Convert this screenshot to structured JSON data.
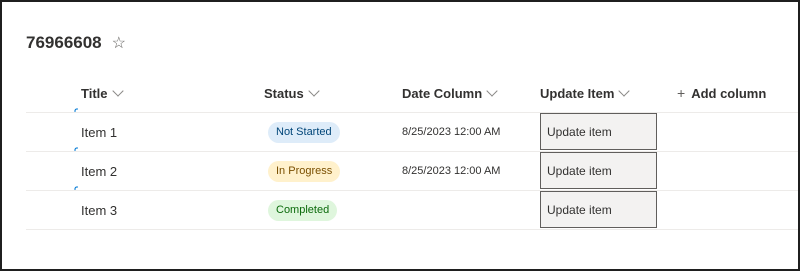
{
  "list": {
    "title": "76966608"
  },
  "columns": {
    "title": "Title",
    "status": "Status",
    "date": "Date Column",
    "update": "Update Item",
    "add": "Add column"
  },
  "rows": [
    {
      "title": "Item 1",
      "status": "Not Started",
      "status_bg": "#deecf9",
      "status_fg": "#004578",
      "date": "8/25/2023 12:00 AM",
      "button": "Update item"
    },
    {
      "title": "Item 2",
      "status": "In Progress",
      "status_bg": "#fff1cc",
      "status_fg": "#7a4f01",
      "date": "8/25/2023 12:00 AM",
      "button": "Update item"
    },
    {
      "title": "Item 3",
      "status": "Completed",
      "status_bg": "#dff6dd",
      "status_fg": "#0b6a0b",
      "date": "",
      "button": "Update item"
    }
  ]
}
